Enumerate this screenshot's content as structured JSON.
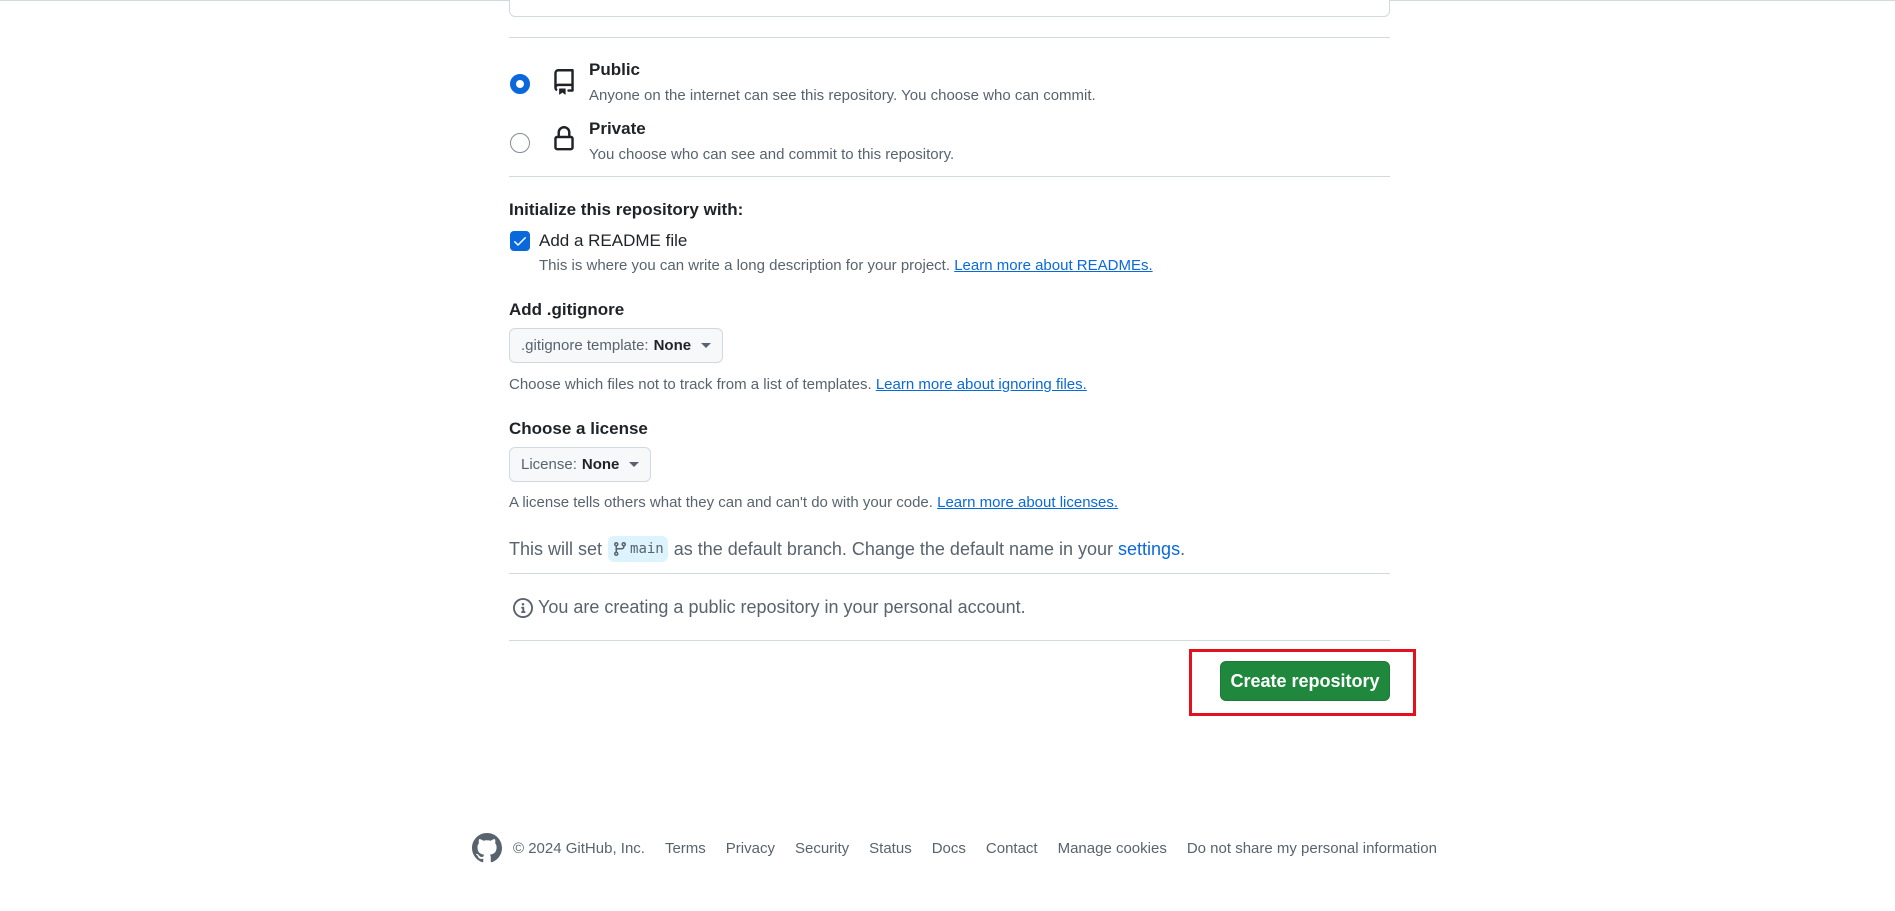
{
  "visibility": {
    "options": [
      {
        "title": "Public",
        "description": "Anyone on the internet can see this repository. You choose who can commit.",
        "selected": true
      },
      {
        "title": "Private",
        "description": "You choose who can see and commit to this repository.",
        "selected": false
      }
    ]
  },
  "init": {
    "heading": "Initialize this repository with:",
    "readme_label": "Add a README file",
    "readme_checked": true,
    "readme_desc": "This is where you can write a long description for your project.",
    "readme_link": "Learn more about READMEs."
  },
  "gitignore": {
    "heading": "Add .gitignore",
    "dropdown_label": ".gitignore template:",
    "dropdown_value": "None",
    "desc": "Choose which files not to track from a list of templates.",
    "link": "Learn more about ignoring files."
  },
  "license": {
    "heading": "Choose a license",
    "dropdown_label": "License:",
    "dropdown_value": "None",
    "desc": "A license tells others what they can and can't do with your code.",
    "link": "Learn more about licenses."
  },
  "branch": {
    "prefix": "This will set",
    "name": "main",
    "middle": "as the default branch. Change the default name in your",
    "link": "settings",
    "suffix": "."
  },
  "info": {
    "text": "You are creating a public repository in your personal account."
  },
  "actions": {
    "create_label": "Create repository"
  },
  "footer": {
    "copyright": "© 2024 GitHub, Inc.",
    "links": [
      "Terms",
      "Privacy",
      "Security",
      "Status",
      "Docs",
      "Contact",
      "Manage cookies",
      "Do not share my personal information"
    ]
  },
  "colors": {
    "accent": "#0969da",
    "primary_button": "#1f883d",
    "highlight": "#e3101e"
  }
}
